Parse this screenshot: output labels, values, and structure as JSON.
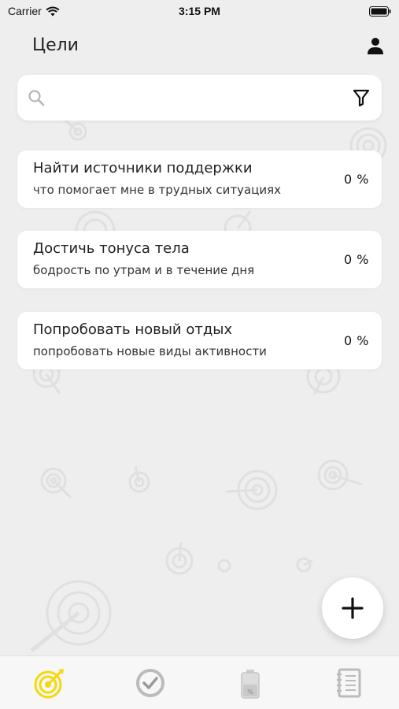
{
  "status_bar": {
    "carrier": "Carrier",
    "time": "3:15 PM"
  },
  "header": {
    "title": "Цели"
  },
  "search": {
    "placeholder": ""
  },
  "goals": [
    {
      "title": "Найти источники поддержки",
      "subtitle": "что помогает мне в трудных ситуациях",
      "progress": "0 %"
    },
    {
      "title": "Достичь тонуса тела",
      "subtitle": "бодрость по утрам и в течение дня",
      "progress": "0 %"
    },
    {
      "title": "Попробовать новый отдых",
      "subtitle": "попробовать новые виды активности",
      "progress": "0 %"
    }
  ],
  "icons": {
    "profile": "person-icon",
    "search": "search-icon",
    "filter": "filter-icon",
    "add": "plus-icon"
  },
  "tab_bar": {
    "selected": "goals",
    "tabs": [
      {
        "id": "goals",
        "icon": "target-icon"
      },
      {
        "id": "progress",
        "icon": "check-circle-icon"
      },
      {
        "id": "energy",
        "icon": "battery-percent-icon"
      },
      {
        "id": "journal",
        "icon": "notebook-icon"
      }
    ]
  },
  "colors": {
    "accent": "#f5d90a",
    "background": "#eeeeee",
    "card": "#ffffff",
    "tab_inactive": "#bbbbbb"
  }
}
